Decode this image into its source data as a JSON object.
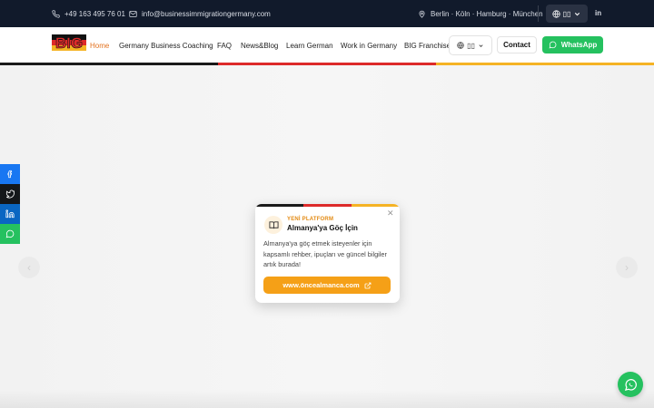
{
  "topbar": {
    "phone": "+49 163 495 76 01",
    "email": "info@businessimmigrationgermany.com",
    "cities": "Berlin · Köln · Hamburg · München",
    "lang_label": "▯▯"
  },
  "nav": {
    "logo_text": "BIG",
    "items": [
      "Home",
      "Germany Business Coaching",
      "FAQ",
      "News&Blog",
      "Learn German",
      "Work in Germany",
      "BIG Franchise"
    ],
    "lang_label": "▯▯",
    "contact": "Contact",
    "whatsapp": "WhatsApp"
  },
  "popup": {
    "tag": "YENİ PLATFORM",
    "title": "Almanya'ya Göç İçin",
    "description": "Almanya'ya göç etmek isteyenler için kapsamlı rehber, ipuçları ve güncel bilgiler artık burada!",
    "cta": "www.öncealmanca.com"
  },
  "colors": {
    "topbar_bg": "#111a2b",
    "accent_orange": "#e3721f",
    "whatsapp_green": "#25c15f",
    "facebook": "#1877f2",
    "twitter": "#14171a",
    "linkedin": "#0a66c2",
    "whatsapp_side": "#25c15f",
    "flag_black": "#1a1a1a",
    "flag_red": "#dd2a2a",
    "flag_gold": "#f5b324"
  }
}
